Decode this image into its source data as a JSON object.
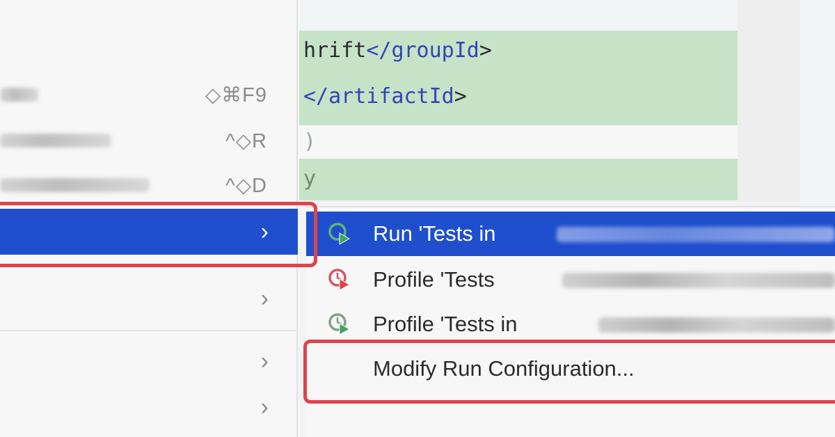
{
  "editor": {
    "lines": [
      {
        "prefix": "hrift",
        "tag_open": "</",
        "tag_name": "groupId",
        "tag_close": ">"
      },
      {
        "prefix": "",
        "tag_open": "</",
        "tag_name": "artifactId",
        "tag_close": ">"
      },
      {
        "text": ")"
      },
      {
        "text": "y"
      }
    ]
  },
  "left_menu": {
    "items": [
      {
        "shortcut": "◇⌘F9"
      },
      {
        "shortcut": "^◇R"
      },
      {
        "shortcut": "^◇D"
      },
      {
        "chevron": "›"
      },
      {
        "chevron": "›"
      },
      {
        "chevron": "›"
      },
      {
        "chevron": "›"
      }
    ]
  },
  "submenu": {
    "items": [
      {
        "label": "Run 'Tests in",
        "icon": "run-tests-icon"
      },
      {
        "label": "Profile 'Tests",
        "icon": "profile-tests-icon"
      },
      {
        "label": "Profile 'Tests in",
        "icon": "profile-coverage-icon"
      },
      {
        "label": "Modify Run Configuration..."
      }
    ]
  },
  "colors": {
    "selection": "#1f4fcc",
    "highlight": "#e0434b",
    "code_bg": "#c6e3c8",
    "tag": "#3245b8"
  }
}
